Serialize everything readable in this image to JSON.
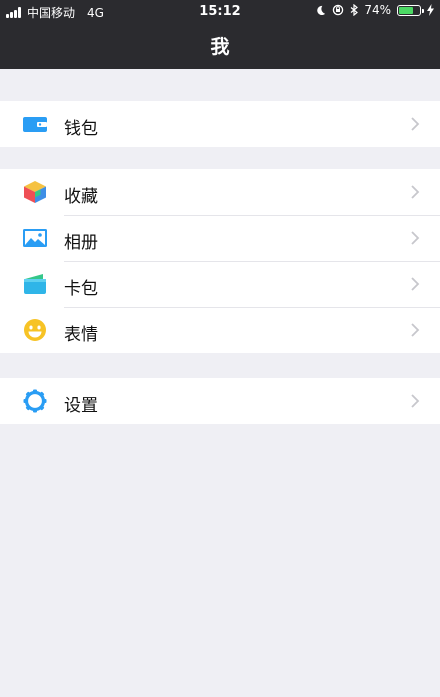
{
  "status_bar": {
    "carrier": "中国移动",
    "network": "4G",
    "time": "15:12",
    "battery_percent": "74%",
    "battery_level": 0.74,
    "battery_color": "#4cd964"
  },
  "nav": {
    "title": "我"
  },
  "groups": [
    {
      "items": [
        {
          "label": "钱包",
          "icon": "wallet-icon"
        }
      ]
    },
    {
      "items": [
        {
          "label": "收藏",
          "icon": "favorites-cube-icon"
        },
        {
          "label": "相册",
          "icon": "album-picture-icon"
        },
        {
          "label": "卡包",
          "icon": "card-pack-icon"
        },
        {
          "label": "表情",
          "icon": "emoji-smile-icon"
        }
      ]
    },
    {
      "items": [
        {
          "label": "设置",
          "icon": "settings-gear-icon"
        }
      ]
    }
  ],
  "colors": {
    "nav_background": "#2b2b2f",
    "page_background": "#efeff4",
    "accent_blue": "#2a9df4"
  }
}
